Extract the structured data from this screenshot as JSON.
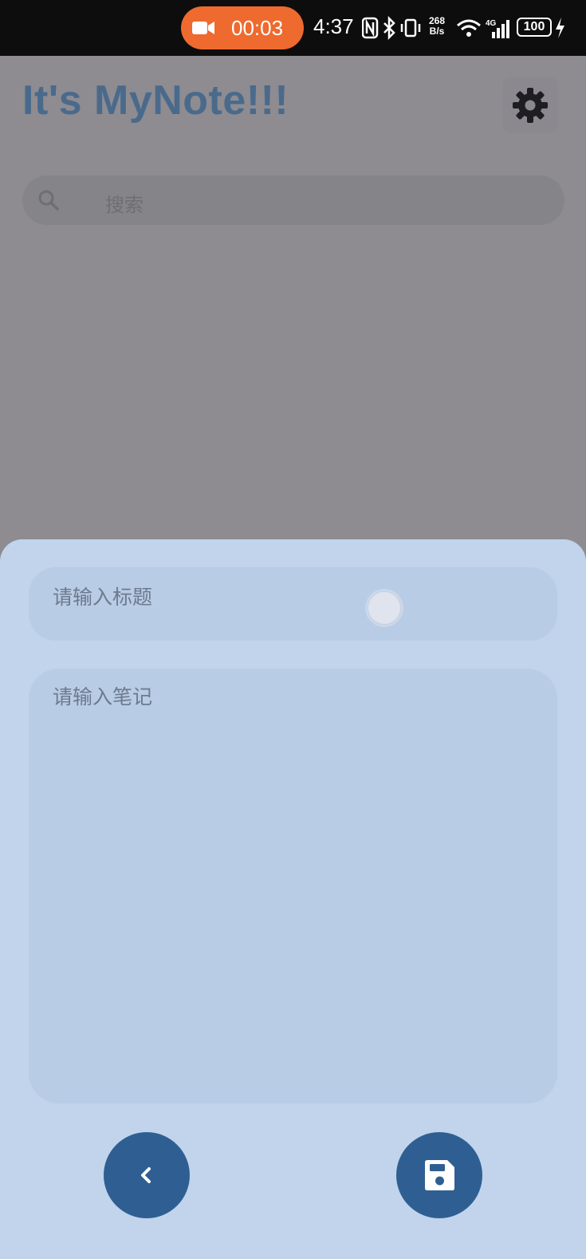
{
  "status_bar": {
    "recording_time": "00:03",
    "clock": "4:37",
    "net_speed_value": "268",
    "net_speed_unit": "B/s",
    "battery": "100",
    "network_type": "4G"
  },
  "header": {
    "title": "It's MyNote!!!",
    "settings_icon": "gear-icon"
  },
  "search": {
    "placeholder": "搜索",
    "icon": "search-icon"
  },
  "editor": {
    "title_placeholder": "请输入标题",
    "note_placeholder": "请输入笔记",
    "back_icon": "chevron-left-icon",
    "save_icon": "floppy-disk-icon"
  },
  "colors": {
    "accent": "#2f5f92",
    "sheet_bg": "#c1d4ec",
    "field_bg": "#b8cce6",
    "recording": "#ee6a2e",
    "scrim": "#8e8c91"
  }
}
